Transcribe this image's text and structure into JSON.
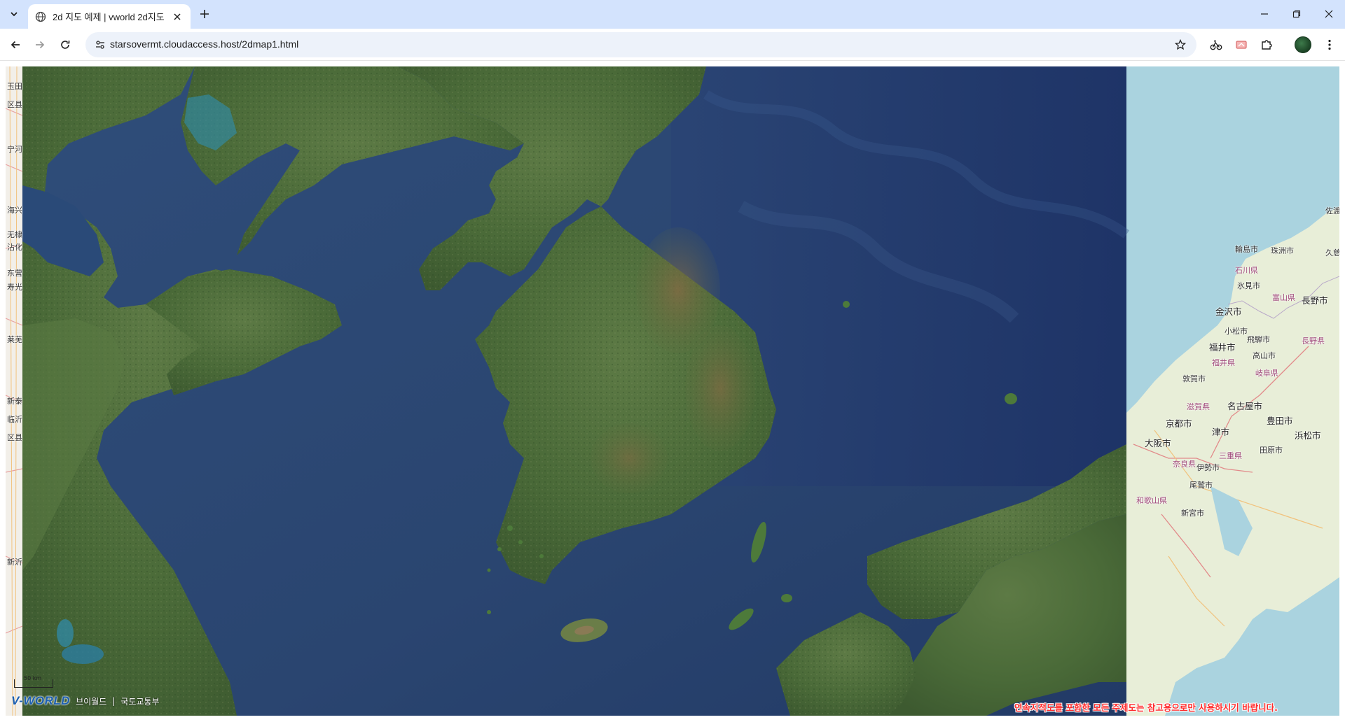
{
  "browser": {
    "tab_title": "2d 지도 예제 | vworld 2d지도",
    "url": "starsovermt.cloudaccess.host/2dmap1.html",
    "accent": "#d3e3fd"
  },
  "map": {
    "scale_label": "50 km",
    "logo_mark": "V-WORLD",
    "logo_text": "브이월드",
    "logo_separator": "|",
    "logo_org": "국토교통부",
    "disclaimer": "연속지적도를 포함한 모든 주제도는 참고용으로만 사용하시기 바랍니다.",
    "colors": {
      "sea_satellite": "#2b4a76",
      "sea_osm": "#aad3df",
      "disclaimer": "#ff2b2b"
    },
    "osm_left_labels": [
      "玉田",
      "区县",
      "宁河",
      "海兴",
      "无棣",
      "沾化",
      "东营",
      "寿光",
      "莱芜",
      "新泰",
      "临沂",
      "区县",
      "新沂"
    ],
    "osm_right_labels": {
      "wajima": "輪島市",
      "suzu": "珠洲市",
      "ishikawa": "石川県",
      "himi": "氷見市",
      "kanazawa": "金沢市",
      "toyama": "富山県",
      "nagano": "長野市",
      "komatsu": "小松市",
      "fukui": "福井市",
      "fukui_pref": "福井県",
      "gifu": "岐阜県",
      "tsuruga": "敦賀市",
      "nagoya": "名古屋市",
      "kyoto": "京都市",
      "shiga": "滋賀県",
      "toyota": "豊田市",
      "osaka": "大阪市",
      "tsu": "津市",
      "hamamatsu": "浜松市",
      "mie": "三重県",
      "nara": "奈良県",
      "wakayama": "和歌山県",
      "shingu": "新宮市",
      "owase": "尾鷲市",
      "ise": "伊勢市",
      "tahara": "田原市",
      "takayama": "高山市",
      "sado": "佐渡",
      "nagano_pref": "長野県",
      "hida": "飛騨市",
      "kuki": "久慈"
    }
  }
}
